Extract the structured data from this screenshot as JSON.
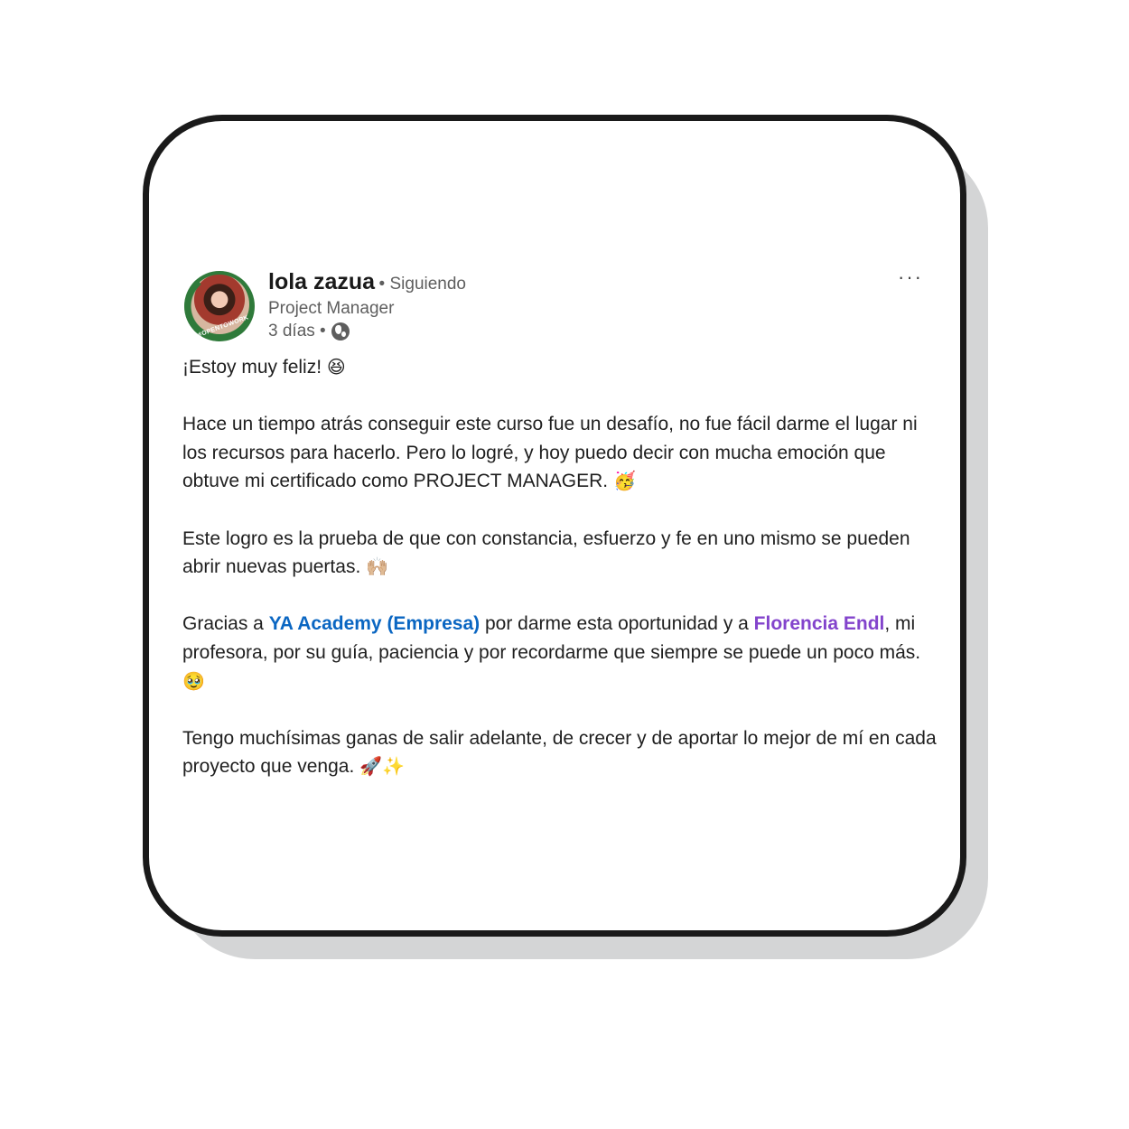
{
  "post": {
    "author_name": "lola zazua",
    "follow_status": "• Siguiendo",
    "author_title": "Project Manager",
    "timestamp": "3 días •",
    "avatar_badge": "#OPENTOWORK",
    "more_menu": "···",
    "visibility_icon": "globe-icon",
    "p1": "¡Estoy muy feliz!",
    "e1": "😆",
    "p2": "Hace un tiempo atrás conseguir este curso fue un desafío, no fue fácil darme el lugar ni los recursos para hacerlo. Pero lo logré, y hoy puedo decir con mucha emoción que obtuve mi certificado como PROJECT MANAGER.",
    "e2": "🥳",
    "p3": "Este logro es la prueba de que con constancia, esfuerzo y fe en uno mismo se pueden abrir nuevas puertas.",
    "e3": "🙌🏼",
    "p4_a": "Gracias a ",
    "p4_link1": "YA Academy (Empresa)",
    "p4_b": " por darme esta oportunidad y a ",
    "p4_link2": "Florencia Endl",
    "p4_c": ", mi profesora, por su guía, paciencia y por recordarme que siempre se puede un poco más.",
    "e4": "🥹",
    "p5": "Tengo muchísimas ganas de salir adelante, de crecer y de aportar lo mejor de mí en cada proyecto que venga.",
    "e5": "🚀✨"
  },
  "colors": {
    "link_company": "#0a66c2",
    "link_person": "#8344cc",
    "card_border": "#1a1a1a",
    "card_shadow": "#d4d5d6"
  }
}
